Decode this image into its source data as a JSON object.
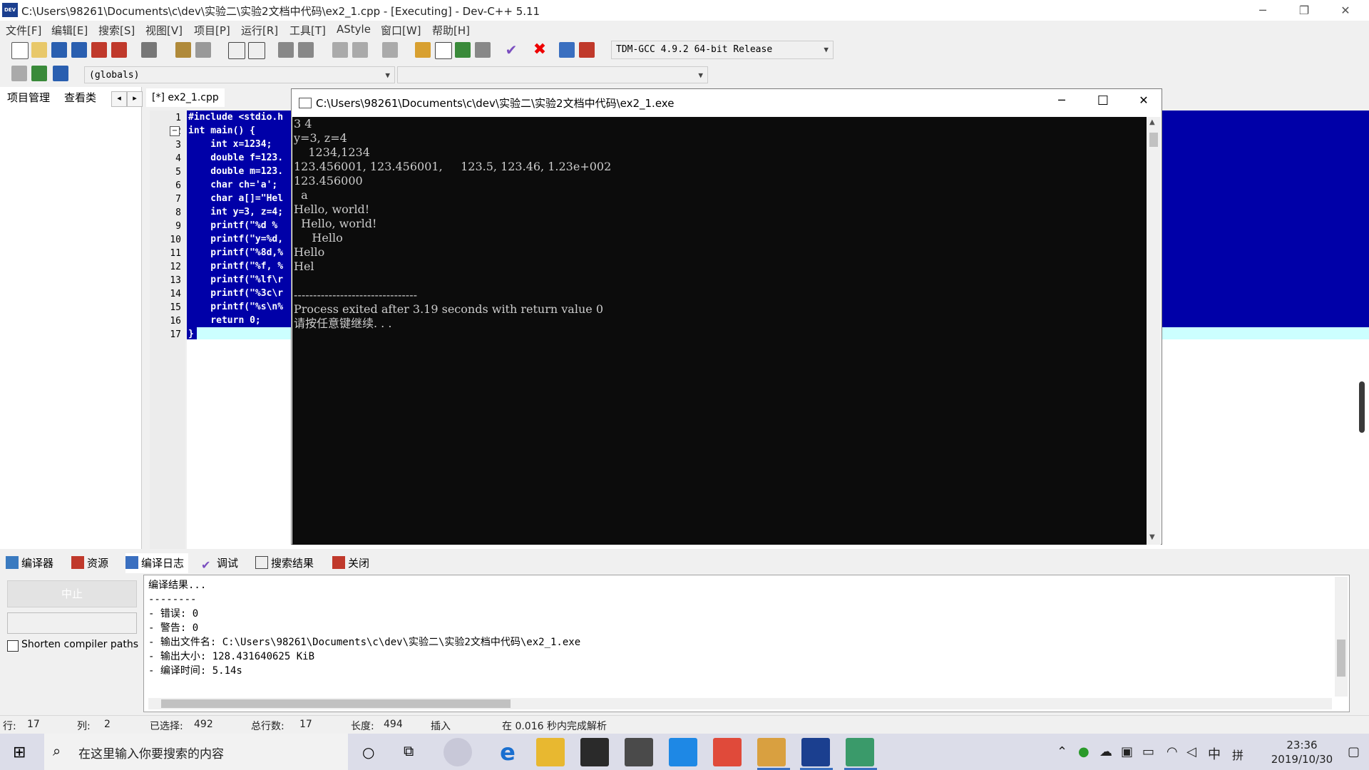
{
  "window": {
    "title": "C:\\Users\\98261\\Documents\\c\\dev\\实验二\\实验2文档中代码\\ex2_1.cpp - [Executing] - Dev-C++ 5.11",
    "icon_label": "DEV",
    "minimize": "─",
    "restore": "❐",
    "close": "✕"
  },
  "menu": [
    "文件[F]",
    "编辑[E]",
    "搜索[S]",
    "视图[V]",
    "项目[P]",
    "运行[R]",
    "工具[T]",
    "AStyle",
    "窗口[W]",
    "帮助[H]"
  ],
  "toolbar": {
    "compiler_select": "TDM-GCC 4.9.2 64-bit Release",
    "scope_select": "(globals)",
    "symbol_select": ""
  },
  "left_panel": {
    "tabs": [
      "项目管理",
      "查看类"
    ],
    "nav_prev": "◂",
    "nav_next": "▸"
  },
  "editor": {
    "tab_label": "[*] ex2_1.cpp",
    "line_numbers": [
      "1",
      "2",
      "3",
      "4",
      "5",
      "6",
      "7",
      "8",
      "9",
      "10",
      "11",
      "12",
      "13",
      "14",
      "15",
      "16",
      "17"
    ],
    "code_lines": [
      "#include <stdio.h",
      "int main() {",
      "    int x=1234;",
      "    double f=123.",
      "    double m=123.",
      "    char ch='a';",
      "    char a[]=\"Hel",
      "    int y=3, z=4;",
      "    printf(\"%d %",
      "    printf(\"y=%d,",
      "    printf(\"%8d,%",
      "    printf(\"%f, %",
      "    printf(\"%lf\\r",
      "    printf(\"%3c\\r",
      "    printf(\"%s\\n%",
      "    return 0;",
      "}"
    ]
  },
  "console": {
    "title": "C:\\Users\\98261\\Documents\\c\\dev\\实验二\\实验2文档中代码\\ex2_1.exe",
    "minimize": "─",
    "maximize": "☐",
    "close": "✕",
    "lines": [
      "3 4",
      "y=3, z=4",
      "    1234,1234",
      "123.456001, 123.456001,     123.5, 123.46, 1.23e+002",
      "123.456000",
      "  a",
      "Hello, world!",
      "  Hello, world!",
      "     Hello",
      "Hello",
      "Hel",
      "",
      "--------------------------------",
      "Process exited after 3.19 seconds with return value 0",
      "请按任意键继续. . ."
    ]
  },
  "bottom_tabs": [
    "编译器",
    "资源",
    "编译日志",
    "调试",
    "搜索结果",
    "关闭"
  ],
  "bottom_panel": {
    "abort_button": "中止",
    "shorten_label": "Shorten compiler paths",
    "log_lines": [
      "编译结果...",
      "--------",
      "- 错误: 0",
      "- 警告: 0",
      "- 输出文件名: C:\\Users\\98261\\Documents\\c\\dev\\实验二\\实验2文档中代码\\ex2_1.exe",
      "- 输出大小: 128.431640625 KiB",
      "- 编译时间: 5.14s"
    ]
  },
  "statusbar": {
    "row_label": "行:",
    "row_value": "17",
    "col_label": "列:",
    "col_value": "2",
    "sel_label": "已选择:",
    "sel_value": "492",
    "lines_label": "总行数:",
    "lines_value": "17",
    "len_label": "长度:",
    "len_value": "494",
    "mode": "插入",
    "parse_msg": "在 0.016 秒内完成解析"
  },
  "taskbar": {
    "search_placeholder": "在这里输入你要搜索的内容",
    "ime_lang": "中",
    "ime_mode": "拼",
    "time": "23:36",
    "date": "2019/10/30"
  },
  "colors": {
    "selection_blue": "#0000a8",
    "current_line": "#ccffff",
    "console_bg": "#0c0c0c",
    "console_text": "#cccccc"
  }
}
